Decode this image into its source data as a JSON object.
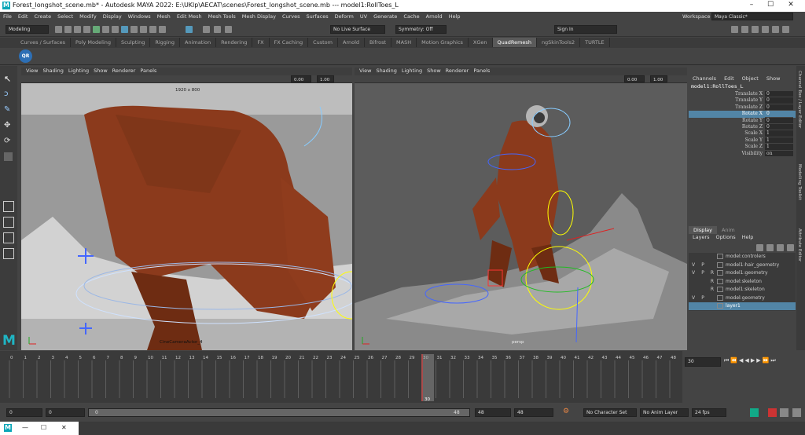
{
  "titlebar": {
    "title": "Forest_longshot_scene.mb* - Autodesk MAYA 2022: E:\\UKlp\\AECAT\\scenes\\Forest_longshot_scene.mb   ---   model1:RollToes_L",
    "logo_letter": "M",
    "minimize": "–",
    "maximize": "☐",
    "close": "✕"
  },
  "menus": [
    "File",
    "Edit",
    "Create",
    "Select",
    "Modify",
    "Display",
    "Windows",
    "Mesh",
    "Edit Mesh",
    "Mesh Tools",
    "Mesh Display",
    "Curves",
    "Surfaces",
    "Deform",
    "UV",
    "Generate",
    "Cache",
    "Arnold",
    "Help"
  ],
  "workspace": {
    "label": "Workspace :",
    "value": "Maya Classic*"
  },
  "toolbar": {
    "mode": "Modeling",
    "live_surface": "No Live Surface",
    "symmetry": "Symmetry: Off",
    "sign_in": "Sign In"
  },
  "shelf_tabs": [
    "Curves / Surfaces",
    "Poly Modeling",
    "Sculpting",
    "Rigging",
    "Animation",
    "Rendering",
    "FX",
    "FX Caching",
    "Custom",
    "Arnold",
    "Bifrost",
    "MASH",
    "Motion Graphics",
    "XGen",
    "QuadRemesh",
    "ngSkinTools2",
    "TURTLE"
  ],
  "shelf_active": "QuadRemesh",
  "shelf_icon_label": "QR",
  "viewport_menus": [
    "View",
    "Shading",
    "Lighting",
    "Show",
    "Renderer",
    "Panels"
  ],
  "viewport_left": {
    "resolution": "1920 x 800",
    "camera": "CineCameraActor_4",
    "near": "0.00",
    "far": "1.00"
  },
  "viewport_right": {
    "camera": "persp",
    "near": "0.00",
    "far": "1.00"
  },
  "channel_box": {
    "menu": [
      "Channels",
      "Edit",
      "Object",
      "Show"
    ],
    "node": "model1:RollToes_L",
    "channels": [
      {
        "name": "Translate X",
        "value": "0"
      },
      {
        "name": "Translate Y",
        "value": "0"
      },
      {
        "name": "Translate Z",
        "value": "0"
      },
      {
        "name": "Rotate X",
        "value": "0"
      },
      {
        "name": "Rotate Y",
        "value": "0"
      },
      {
        "name": "Rotate Z",
        "value": "0"
      },
      {
        "name": "Scale X",
        "value": "1"
      },
      {
        "name": "Scale Y",
        "value": "1"
      },
      {
        "name": "Scale Z",
        "value": "1"
      },
      {
        "name": "Visibility",
        "value": "on"
      }
    ],
    "selected_index": 3
  },
  "layer_panel": {
    "tabs": [
      "Display",
      "Anim"
    ],
    "menu": [
      "Layers",
      "Options",
      "Help"
    ],
    "layers": [
      {
        "v": "",
        "p": "",
        "r": "",
        "name": "model:controlers"
      },
      {
        "v": "V",
        "p": "P",
        "r": "",
        "name": "model1:hair_geometry"
      },
      {
        "v": "V",
        "p": "P",
        "r": "R",
        "name": "model1:geometry"
      },
      {
        "v": "",
        "p": "",
        "r": "R",
        "name": "model:skeleton"
      },
      {
        "v": "",
        "p": "",
        "r": "R",
        "name": "model1:skeleton"
      },
      {
        "v": "V",
        "p": "P",
        "r": "",
        "name": "model:geometry"
      },
      {
        "v": "",
        "p": "",
        "r": "",
        "name": "layer1"
      }
    ],
    "selected_index": 6
  },
  "side_tabs": [
    "Channel Box / Layer Editor",
    "Modelling Toolkit",
    "Attribute Editor"
  ],
  "timeline": {
    "ticks": [
      "0",
      "1",
      "2",
      "3",
      "4",
      "5",
      "6",
      "7",
      "8",
      "9",
      "10",
      "11",
      "12",
      "13",
      "14",
      "15",
      "16",
      "17",
      "18",
      "19",
      "20",
      "21",
      "22",
      "23",
      "24",
      "25",
      "26",
      "27",
      "28",
      "29",
      "30",
      "31",
      "32",
      "33",
      "34",
      "35",
      "36",
      "37",
      "38",
      "39",
      "40",
      "41",
      "42",
      "43",
      "44",
      "45",
      "46",
      "47",
      "48"
    ],
    "current": "30",
    "current_field": "30"
  },
  "range": {
    "start": "0",
    "start2": "0",
    "slider_start": "0",
    "slider_end": "48",
    "end": "48",
    "end2": "48",
    "character_set": "No Character Set",
    "anim_layer": "No Anim Layer",
    "fps": "24 fps"
  },
  "taskbar": {
    "logo": "M",
    "min": "—",
    "restore": "☐",
    "close": "✕"
  }
}
